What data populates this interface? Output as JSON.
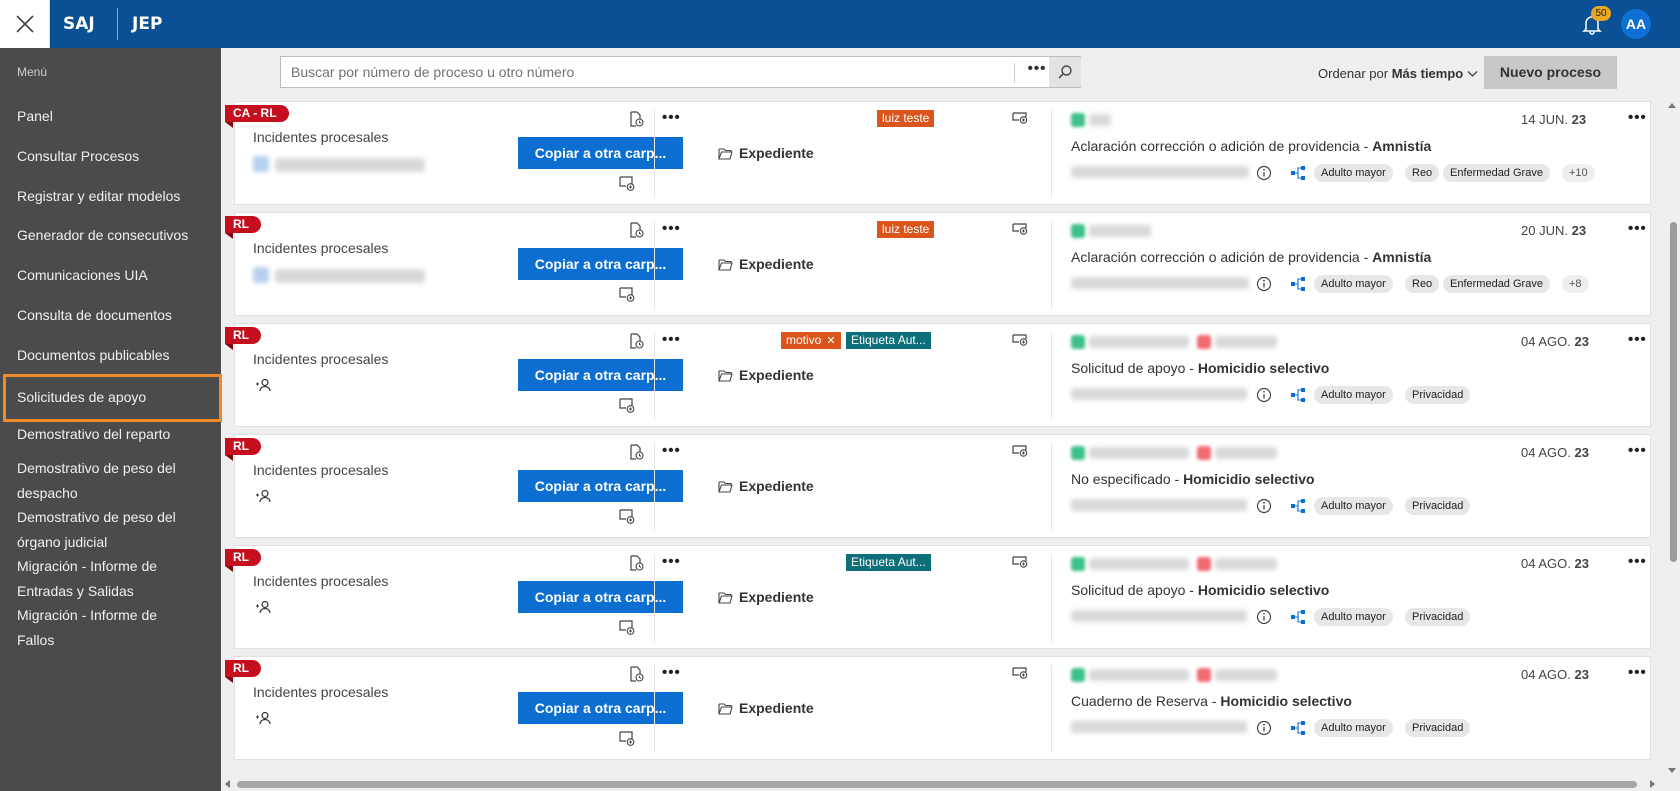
{
  "header": {
    "brand1": "SAJ",
    "brand2": "JEP",
    "notifications": "50",
    "avatar": "AA"
  },
  "sidebar": {
    "title": "Menú",
    "items": [
      "Panel",
      "Consultar Procesos",
      "Registrar y editar modelos",
      "Generador de consecutivos",
      "Comunicaciones UIA",
      "Consulta de documentos",
      "Documentos publicables",
      "Solicitudes de apoyo",
      "Demostrativo del reparto",
      "Demostrativo de peso del",
      "despacho",
      "Demostrativo de peso del",
      "órgano judicial",
      "Migración - Informe de",
      "Entradas y Salidas",
      "Migración - Informe de",
      "Fallos"
    ]
  },
  "search": {
    "placeholder": "Buscar por número de proceso u otro número",
    "value": ""
  },
  "toolbar": {
    "sort_label": "Ordenar por",
    "sort_value": "Más tiempo",
    "new_button": "Nuevo proceso"
  },
  "cards": [
    {
      "ribbon": "CA - RL",
      "type": "Incidentes procesales",
      "copy": "Copiar a otra carp...",
      "folder": "Expediente",
      "tags": [
        "luiz teste"
      ],
      "date_day": "14 JUN.",
      "date_year": "23",
      "desc_main": "Aclaración corrección o adición de providencia - ",
      "desc_bold": "Amnistía",
      "chips": [
        "Adulto mayor",
        "Reo",
        "Enfermedad Grave",
        "+10"
      ]
    },
    {
      "ribbon": "RL",
      "type": "Incidentes procesales",
      "copy": "Copiar a otra carp...",
      "folder": "Expediente",
      "tags": [
        "luiz teste"
      ],
      "date_day": "20 JUN.",
      "date_year": "23",
      "desc_main": "Aclaración corrección o adición de providencia - ",
      "desc_bold": "Amnistía",
      "chips": [
        "Adulto mayor",
        "Reo",
        "Enfermedad Grave",
        "+8"
      ]
    },
    {
      "ribbon": "RL",
      "type": "Incidentes procesales",
      "copy": "Copiar a otra carp...",
      "folder": "Expediente",
      "tags": [
        "motivo",
        "Etiqueta Aut..."
      ],
      "date_day": "04 AGO.",
      "date_year": "23",
      "desc_main": "Solicitud de apoyo - ",
      "desc_bold": "Homicidio selectivo",
      "chips": [
        "Adulto mayor",
        "Privacidad"
      ]
    },
    {
      "ribbon": "RL",
      "type": "Incidentes procesales",
      "copy": "Copiar a otra carp...",
      "folder": "Expediente",
      "tags": [],
      "date_day": "04 AGO.",
      "date_year": "23",
      "desc_main": "No especificado - ",
      "desc_bold": "Homicidio selectivo",
      "chips": [
        "Adulto mayor",
        "Privacidad"
      ]
    },
    {
      "ribbon": "RL",
      "type": "Incidentes procesales",
      "copy": "Copiar a otra carp...",
      "folder": "Expediente",
      "tags": [
        "Etiqueta Aut..."
      ],
      "date_day": "04 AGO.",
      "date_year": "23",
      "desc_main": "Solicitud de apoyo - ",
      "desc_bold": "Homicidio selectivo",
      "chips": [
        "Adulto mayor",
        "Privacidad"
      ]
    },
    {
      "ribbon": "RL",
      "type": "Incidentes procesales",
      "copy": "Copiar a otra carp...",
      "folder": "Expediente",
      "tags": [],
      "date_day": "04 AGO.",
      "date_year": "23",
      "desc_main": "Cuaderno de Reserva - ",
      "desc_bold": "Homicidio selectivo",
      "chips": [
        "Adulto mayor",
        "Privacidad"
      ]
    }
  ],
  "colors": {
    "header": "#0b4f94",
    "sidebar": "#4b4b4b",
    "accent_button": "#0b6ed0",
    "ribbon": "#c50f1f",
    "tag_orange": "#d9551c",
    "tag_teal": "#0d6f7a",
    "active_outline": "#ef8a2b"
  }
}
